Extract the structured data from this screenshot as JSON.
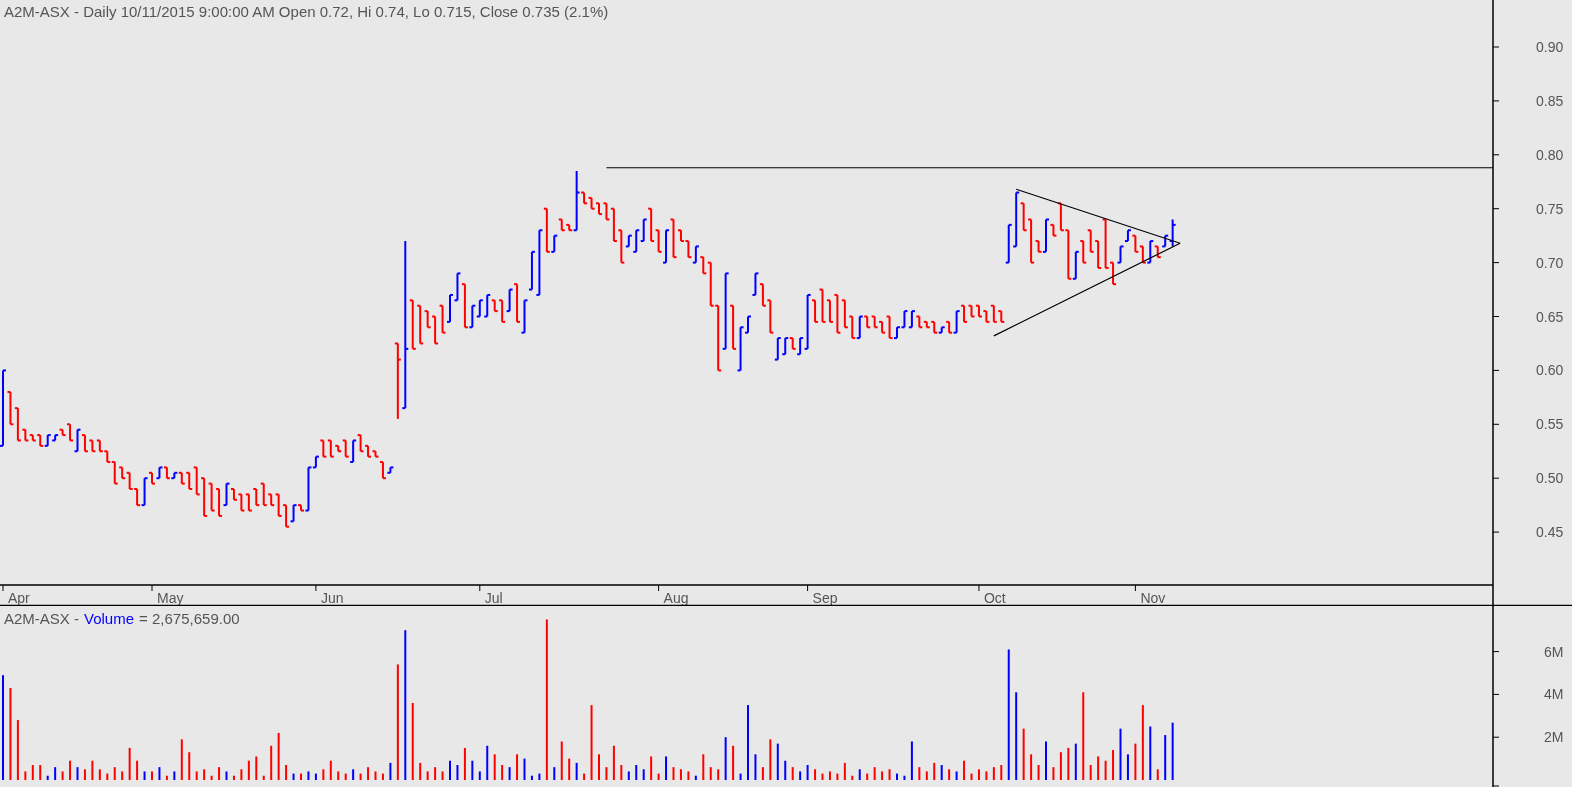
{
  "price_chart": {
    "title": "A2M-ASX - Daily 10/11/2015 9:00:00 AM Open 0.72, Hi 0.74, Lo 0.715, Close 0.735 (2.1%)",
    "y_axis_labels": [
      "0.90",
      "0.85",
      "0.80",
      "0.75",
      "0.70",
      "0.65",
      "0.60",
      "0.55",
      "0.50",
      "0.45"
    ],
    "month_labels": [
      "Apr",
      "May",
      "Jun",
      "Jul",
      "Aug",
      "Sep",
      "Oct",
      "Nov"
    ]
  },
  "volume_chart": {
    "legend": {
      "symbol": "A2M-ASX -",
      "label": "Volume",
      "value": "= 2,675,659.00"
    },
    "y_axis_labels": [
      "6M",
      "4M",
      "2M"
    ]
  }
}
